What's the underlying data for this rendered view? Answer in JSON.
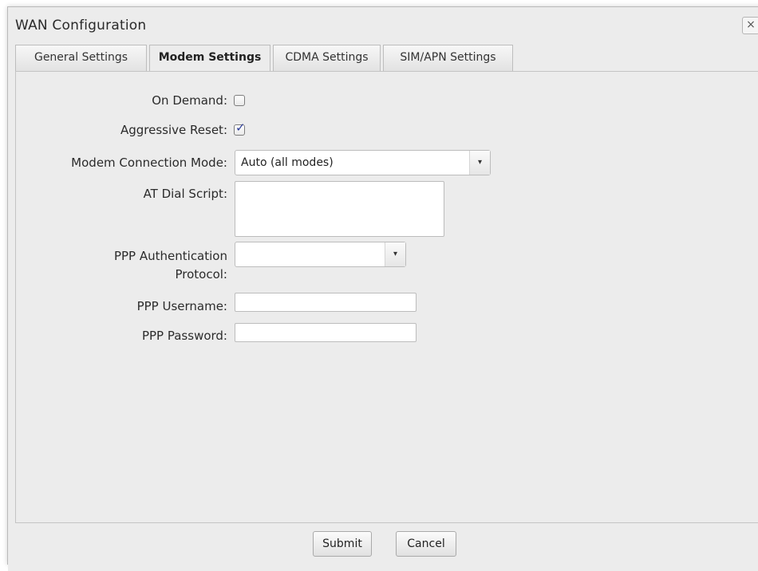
{
  "dialog": {
    "title": "WAN Configuration",
    "close_glyph": "×"
  },
  "tabs": [
    {
      "label": "General Settings",
      "active": false
    },
    {
      "label": "Modem Settings",
      "active": true
    },
    {
      "label": "CDMA Settings",
      "active": false
    },
    {
      "label": "SIM/APN Settings",
      "active": false
    }
  ],
  "form": {
    "on_demand": {
      "label": "On Demand:",
      "checked": false
    },
    "aggressive_reset": {
      "label": "Aggressive Reset:",
      "checked": true,
      "check_glyph": "✓"
    },
    "connection_mode": {
      "label": "Modem Connection Mode:",
      "value": "Auto (all modes)"
    },
    "at_dial_script": {
      "label": "AT Dial Script:",
      "value": ""
    },
    "ppp_auth": {
      "label_line1": "PPP Authentication",
      "label_line2": "Protocol:",
      "value": ""
    },
    "ppp_username": {
      "label": "PPP Username:",
      "value": ""
    },
    "ppp_password": {
      "label": "PPP Password:",
      "value": ""
    }
  },
  "select_arrow_glyph": "▾",
  "buttons": {
    "submit": "Submit",
    "cancel": "Cancel"
  },
  "colors": {
    "dialog_bg": "#ececec",
    "checkmark": "#2d3e9a"
  },
  "icons": {
    "close": "close-icon",
    "dropdown": "chevron-down-icon",
    "check": "checkmark-icon"
  }
}
